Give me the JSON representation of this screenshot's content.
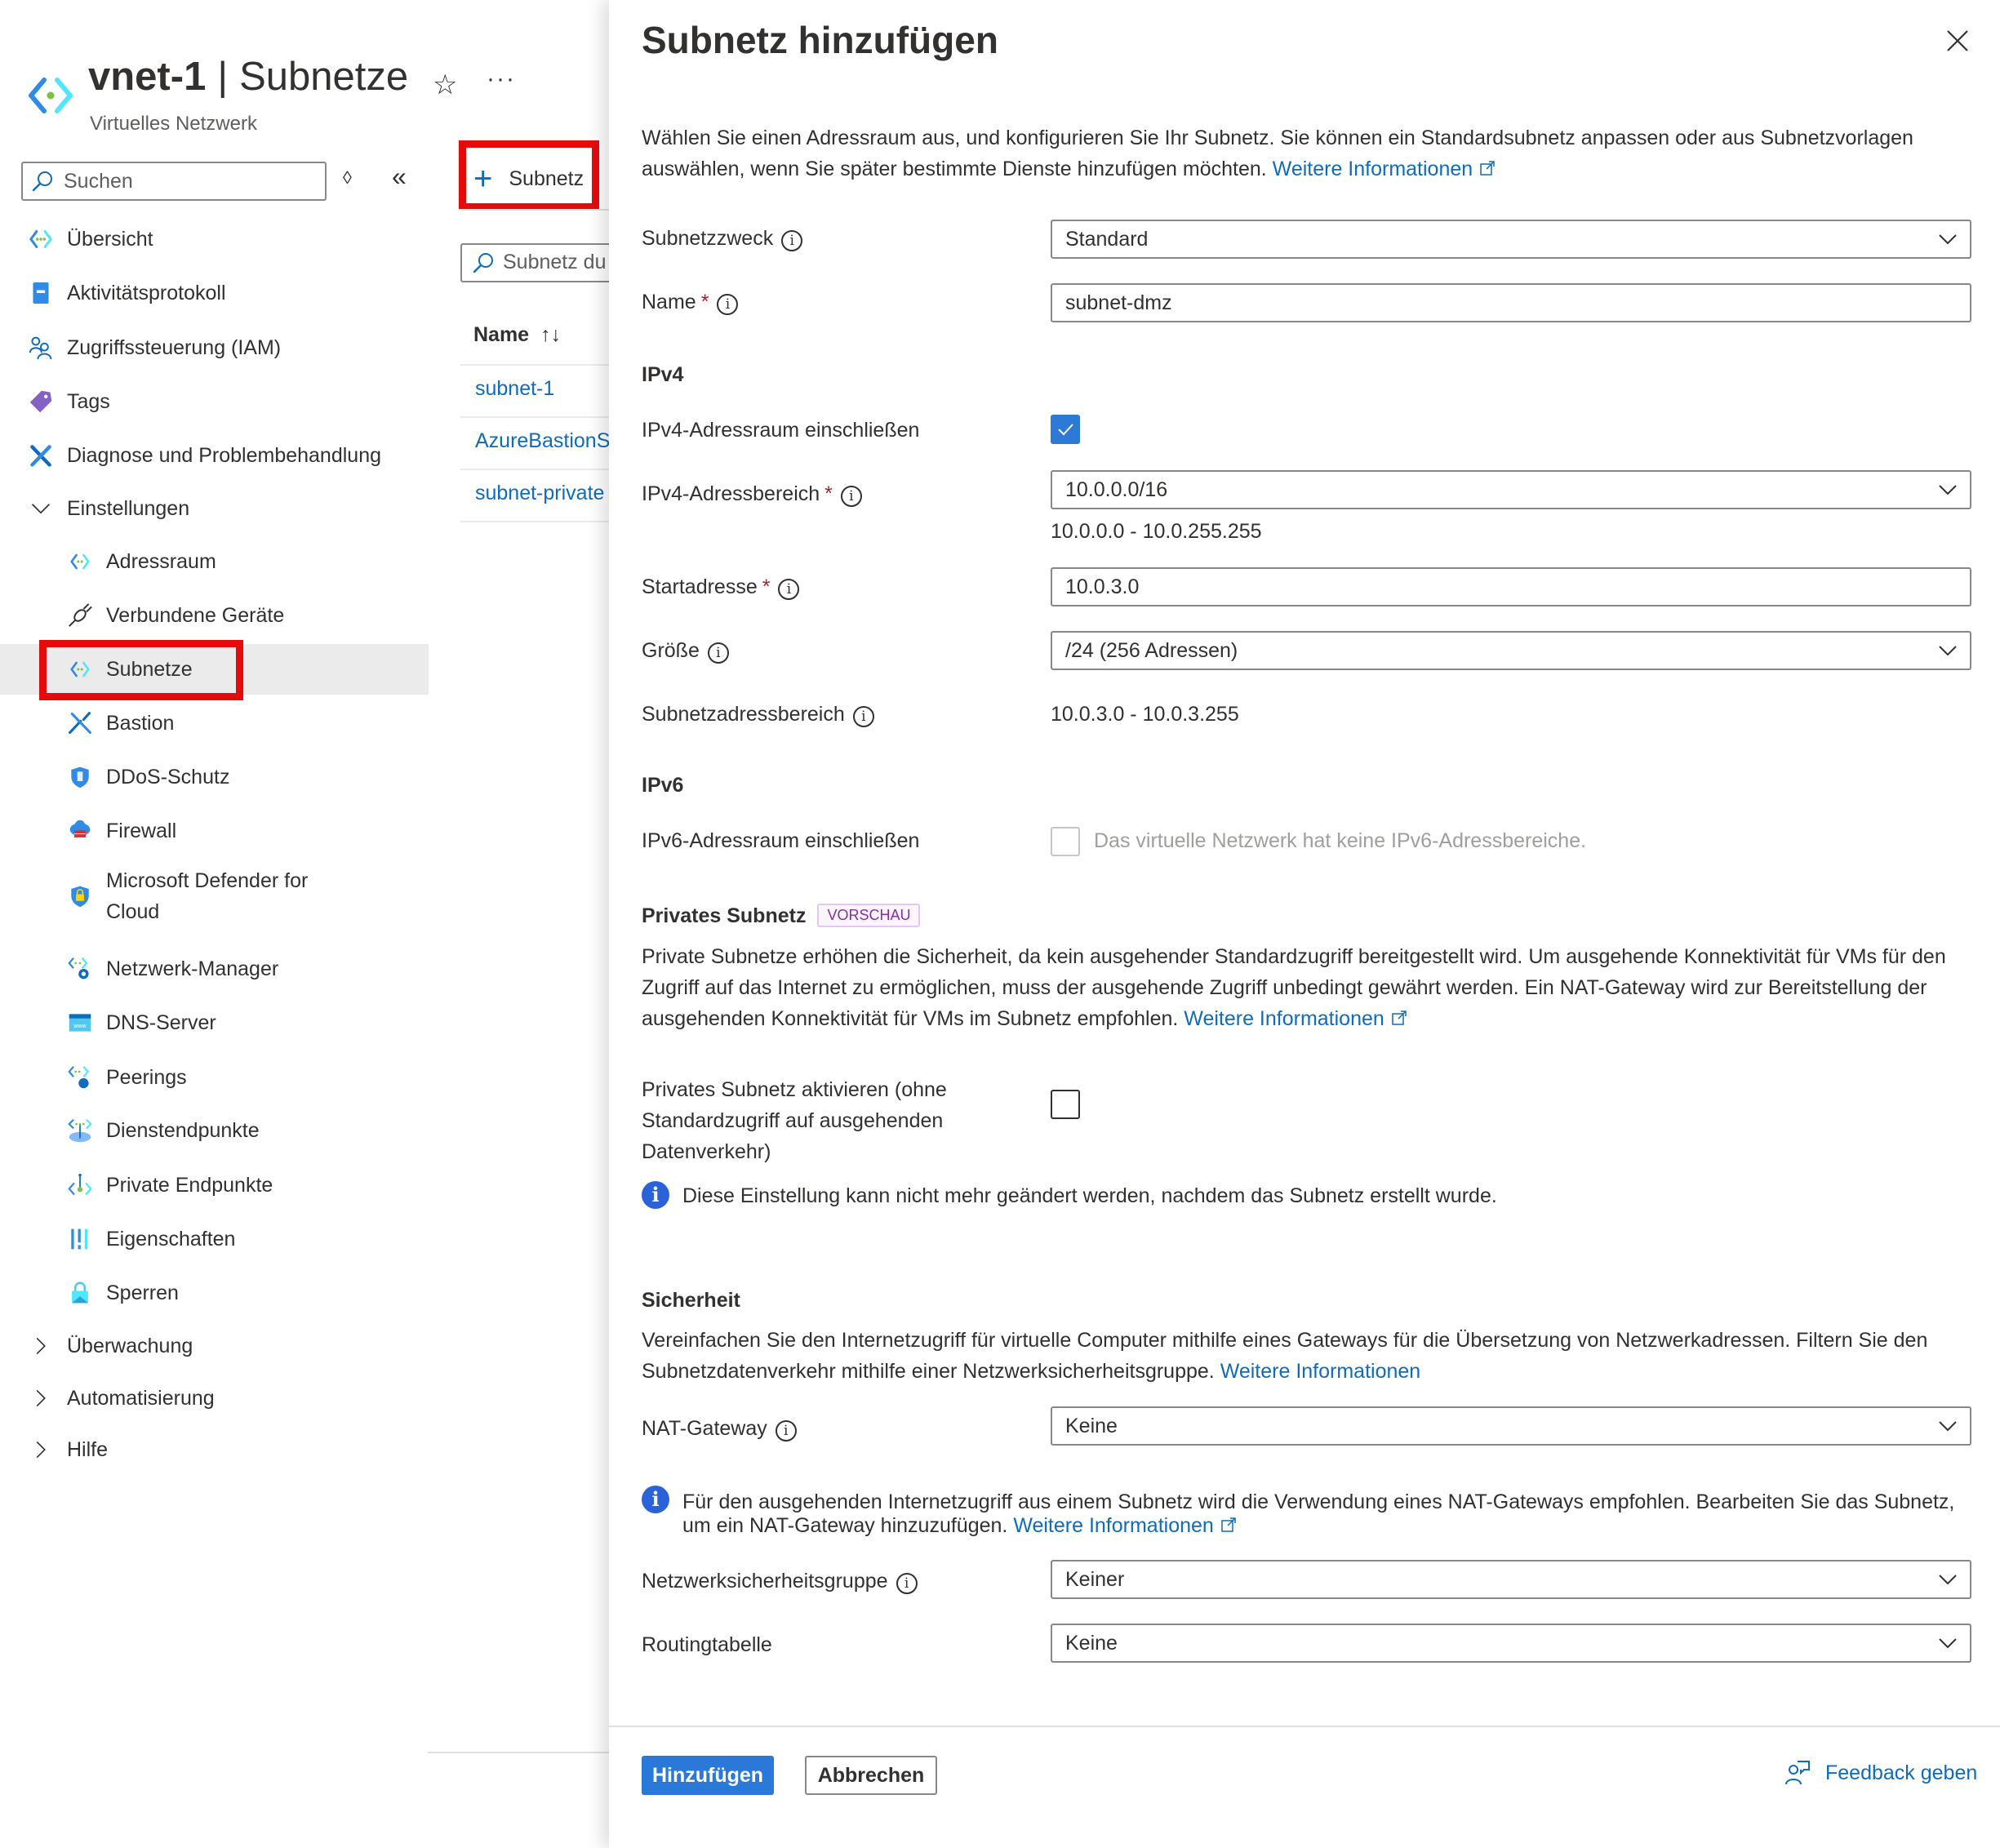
{
  "blade": {
    "resource_name": "vnet-1",
    "separator": "|",
    "section_name": "Subnetze",
    "subtitle": "Virtuelles Netzwerk",
    "favorite_icon": "star-icon",
    "more_icon": "ellipsis-icon"
  },
  "sidebar": {
    "search_placeholder": "Suchen",
    "items": [
      {
        "label": "Übersicht",
        "icon": "vnet-overview-icon",
        "level": 1
      },
      {
        "label": "Aktivitätsprotokoll",
        "icon": "activity-log-icon",
        "level": 1
      },
      {
        "label": "Zugriffssteuerung (IAM)",
        "icon": "iam-people-icon",
        "level": 1
      },
      {
        "label": "Tags",
        "icon": "tag-icon",
        "level": 1
      },
      {
        "label": "Diagnose und Problembehandlung",
        "icon": "wrench-icon",
        "level": 1
      },
      {
        "label": "Einstellungen",
        "icon": "chevron-down-icon",
        "level": 1,
        "expanded": true
      },
      {
        "label": "Adressraum",
        "icon": "vnet-icon",
        "level": 2
      },
      {
        "label": "Verbundene Geräte",
        "icon": "plug-icon",
        "level": 2
      },
      {
        "label": "Subnetze",
        "icon": "vnet-icon",
        "level": 2,
        "selected": true
      },
      {
        "label": "Bastion",
        "icon": "bastion-icon",
        "level": 2
      },
      {
        "label": "DDoS-Schutz",
        "icon": "ddos-shield-icon",
        "level": 2
      },
      {
        "label": "Firewall",
        "icon": "firewall-icon",
        "level": 2
      },
      {
        "label": "Microsoft Defender for Cloud",
        "icon": "defender-shield-icon",
        "level": 2
      },
      {
        "label": "Netzwerk-Manager",
        "icon": "network-manager-icon",
        "level": 2
      },
      {
        "label": "DNS-Server",
        "icon": "dns-icon",
        "level": 2
      },
      {
        "label": "Peerings",
        "icon": "peering-icon",
        "level": 2
      },
      {
        "label": "Dienstendpunkte",
        "icon": "service-endpoint-icon",
        "level": 2
      },
      {
        "label": "Private Endpunkte",
        "icon": "private-endpoint-icon",
        "level": 2
      },
      {
        "label": "Eigenschaften",
        "icon": "properties-icon",
        "level": 2
      },
      {
        "label": "Sperren",
        "icon": "lock-icon",
        "level": 2
      },
      {
        "label": "Überwachung",
        "icon": "chevron-right-icon",
        "level": 1,
        "expanded": false
      },
      {
        "label": "Automatisierung",
        "icon": "chevron-right-icon",
        "level": 1,
        "expanded": false
      },
      {
        "label": "Hilfe",
        "icon": "chevron-right-icon",
        "level": 1,
        "expanded": false
      }
    ]
  },
  "list": {
    "add_button_label": "Subnetz",
    "filter_placeholder": "Subnetz du",
    "column_name": "Name",
    "sort_icon": "↑↓",
    "rows": [
      "subnet-1",
      "AzureBastionS",
      "subnet-private"
    ]
  },
  "panel": {
    "title": "Subnetz hinzufügen",
    "intro": "Wählen Sie einen Adressraum aus, und konfigurieren Sie Ihr Subnetz. Sie können ein Standardsubnetz anpassen oder aus Subnetzvorlagen auswählen, wenn Sie später bestimmte Dienste hinzufügen möchten.",
    "learn_more": "Weitere Informationen",
    "fields": {
      "purpose_label": "Subnetzzweck",
      "purpose_value": "Standard",
      "name_label": "Name",
      "name_value": "subnet-dmz",
      "ipv4_heading": "IPv4",
      "ipv4_include_label": "IPv4-Adressraum einschließen",
      "ipv4_include_checked": true,
      "ipv4_range_label": "IPv4-Adressbereich",
      "ipv4_range_value": "10.0.0.0/16",
      "ipv4_range_hint": "10.0.0.0 - 10.0.255.255",
      "start_label": "Startadresse",
      "start_value": "10.0.3.0",
      "size_label": "Größe",
      "size_value": "/24 (256 Adressen)",
      "subnet_range_label": "Subnetzadressbereich",
      "subnet_range_value": "10.0.3.0 - 10.0.3.255",
      "ipv6_heading": "IPv6",
      "ipv6_include_label": "IPv6-Adressraum einschließen",
      "ipv6_include_checked": false,
      "ipv6_disabled_text": "Das virtuelle Netzwerk hat keine IPv6-Adressbereiche."
    },
    "private_subnet": {
      "heading": "Privates Subnetz",
      "badge": "VORSCHAU",
      "description": "Private Subnetze erhöhen die Sicherheit, da kein ausgehender Standardzugriff bereitgestellt wird. Um ausgehende Konnektivität für VMs für den Zugriff auf das Internet zu ermöglichen, muss der ausgehende Zugriff unbedingt gewährt werden. Ein NAT-Gateway wird zur Bereitstellung der ausgehenden Konnektivität für VMs im Subnetz empfohlen.",
      "learn_more": "Weitere Informationen",
      "enable_label": "Privates Subnetz aktivieren (ohne Standardzugriff auf ausgehenden Datenverkehr)",
      "enable_checked": false,
      "note": "Diese Einstellung kann nicht mehr geändert werden, nachdem das Subnetz erstellt wurde."
    },
    "security": {
      "heading": "Sicherheit",
      "description": "Vereinfachen Sie den Internetzugriff für virtuelle Computer mithilfe eines Gateways für die Übersetzung von Netzwerkadressen. Filtern Sie den Subnetzdatenverkehr mithilfe einer Netzwerksicherheitsgruppe.",
      "learn_more": "Weitere Informationen",
      "nat_label": "NAT-Gateway",
      "nat_value": "Keine",
      "nat_note": "Für den ausgehenden Internetzugriff aus einem Subnetz wird die Verwendung eines NAT-Gateways empfohlen. Bearbeiten Sie das Subnetz, um ein NAT-Gateway hinzuzufügen.",
      "nat_note_link": "Weitere Informationen",
      "nsg_label": "Netzwerksicherheitsgruppe",
      "nsg_value": "Keiner",
      "route_label": "Routingtabelle",
      "route_value": "Keine"
    },
    "footer": {
      "add_button": "Hinzufügen",
      "cancel_button": "Abbrechen",
      "feedback": "Feedback geben"
    }
  },
  "colors": {
    "accent": "#0f6cbd",
    "primary_button": "#2a78d8",
    "highlight_box": "#e50b0b",
    "selected_nav": "#ebebeb",
    "required": "#a4262c",
    "badge_text": "#8a2da5"
  }
}
